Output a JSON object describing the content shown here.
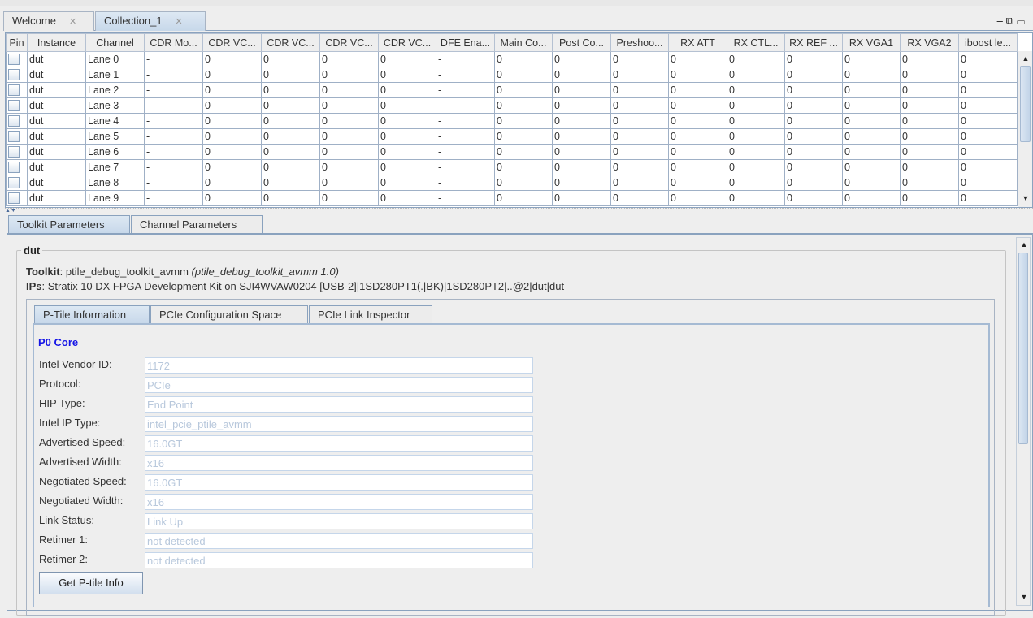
{
  "editor_tabs": [
    {
      "label": "Welcome"
    },
    {
      "label": "Collection_1"
    }
  ],
  "window_controls": {
    "minimize": "–",
    "restore": "⧉",
    "maximize": "▭"
  },
  "table": {
    "columns": [
      "Pin",
      "Instance",
      "Channel",
      "CDR Mo...",
      "CDR VC...",
      "CDR VC...",
      "CDR VC...",
      "CDR VC...",
      "DFE Ena...",
      "Main Co...",
      "Post Co...",
      "Preshoo...",
      "RX ATT",
      "RX CTL...",
      "RX REF ...",
      "RX VGA1",
      "RX VGA2",
      "iboost le..."
    ],
    "rows": [
      [
        "dut",
        "Lane 0",
        "-",
        "0",
        "0",
        "0",
        "0",
        "-",
        "0",
        "0",
        "0",
        "0",
        "0",
        "0",
        "0",
        "0",
        "0"
      ],
      [
        "dut",
        "Lane 1",
        "-",
        "0",
        "0",
        "0",
        "0",
        "-",
        "0",
        "0",
        "0",
        "0",
        "0",
        "0",
        "0",
        "0",
        "0"
      ],
      [
        "dut",
        "Lane 2",
        "-",
        "0",
        "0",
        "0",
        "0",
        "-",
        "0",
        "0",
        "0",
        "0",
        "0",
        "0",
        "0",
        "0",
        "0"
      ],
      [
        "dut",
        "Lane 3",
        "-",
        "0",
        "0",
        "0",
        "0",
        "-",
        "0",
        "0",
        "0",
        "0",
        "0",
        "0",
        "0",
        "0",
        "0"
      ],
      [
        "dut",
        "Lane 4",
        "-",
        "0",
        "0",
        "0",
        "0",
        "-",
        "0",
        "0",
        "0",
        "0",
        "0",
        "0",
        "0",
        "0",
        "0"
      ],
      [
        "dut",
        "Lane 5",
        "-",
        "0",
        "0",
        "0",
        "0",
        "-",
        "0",
        "0",
        "0",
        "0",
        "0",
        "0",
        "0",
        "0",
        "0"
      ],
      [
        "dut",
        "Lane 6",
        "-",
        "0",
        "0",
        "0",
        "0",
        "-",
        "0",
        "0",
        "0",
        "0",
        "0",
        "0",
        "0",
        "0",
        "0"
      ],
      [
        "dut",
        "Lane 7",
        "-",
        "0",
        "0",
        "0",
        "0",
        "-",
        "0",
        "0",
        "0",
        "0",
        "0",
        "0",
        "0",
        "0",
        "0"
      ],
      [
        "dut",
        "Lane 8",
        "-",
        "0",
        "0",
        "0",
        "0",
        "-",
        "0",
        "0",
        "0",
        "0",
        "0",
        "0",
        "0",
        "0",
        "0"
      ],
      [
        "dut",
        "Lane 9",
        "-",
        "0",
        "0",
        "0",
        "0",
        "-",
        "0",
        "0",
        "0",
        "0",
        "0",
        "0",
        "0",
        "0",
        "0"
      ]
    ]
  },
  "param_tabs": [
    {
      "label": "Toolkit Parameters"
    },
    {
      "label": "Channel Parameters"
    }
  ],
  "group": {
    "title": "dut",
    "toolkit_label": "Toolkit",
    "toolkit_value": ": ptile_debug_toolkit_avmm ",
    "toolkit_version": "(ptile_debug_toolkit_avmm 1.0)",
    "ips_label": "IPs",
    "ips_value": ": Stratix 10 DX FPGA Development Kit on SJI4WVAW0204 [USB-2]|1SD280PT1(.|BK)|1SD280PT2|..@2|dut|dut"
  },
  "inner_tabs": [
    {
      "label": "P-Tile Information"
    },
    {
      "label": "PCIe Configuration Space"
    },
    {
      "label": "PCIe Link Inspector"
    }
  ],
  "ptile": {
    "heading": "P0 Core",
    "fields": [
      {
        "label": "Intel Vendor ID:",
        "value": "1172"
      },
      {
        "label": "Protocol:",
        "value": "PCIe"
      },
      {
        "label": "HIP Type:",
        "value": "End Point"
      },
      {
        "label": "Intel IP Type:",
        "value": "intel_pcie_ptile_avmm"
      },
      {
        "label": "Advertised Speed:",
        "value": "16.0GT"
      },
      {
        "label": "Advertised Width:",
        "value": "x16"
      },
      {
        "label": "Negotiated Speed:",
        "value": "16.0GT"
      },
      {
        "label": "Negotiated Width:",
        "value": "x16"
      },
      {
        "label": "Link Status:",
        "value": "Link Up"
      },
      {
        "label": "Retimer 1:",
        "value": "not detected"
      },
      {
        "label": "Retimer 2:",
        "value": "not detected"
      }
    ],
    "button": "Get P-tile Info"
  }
}
